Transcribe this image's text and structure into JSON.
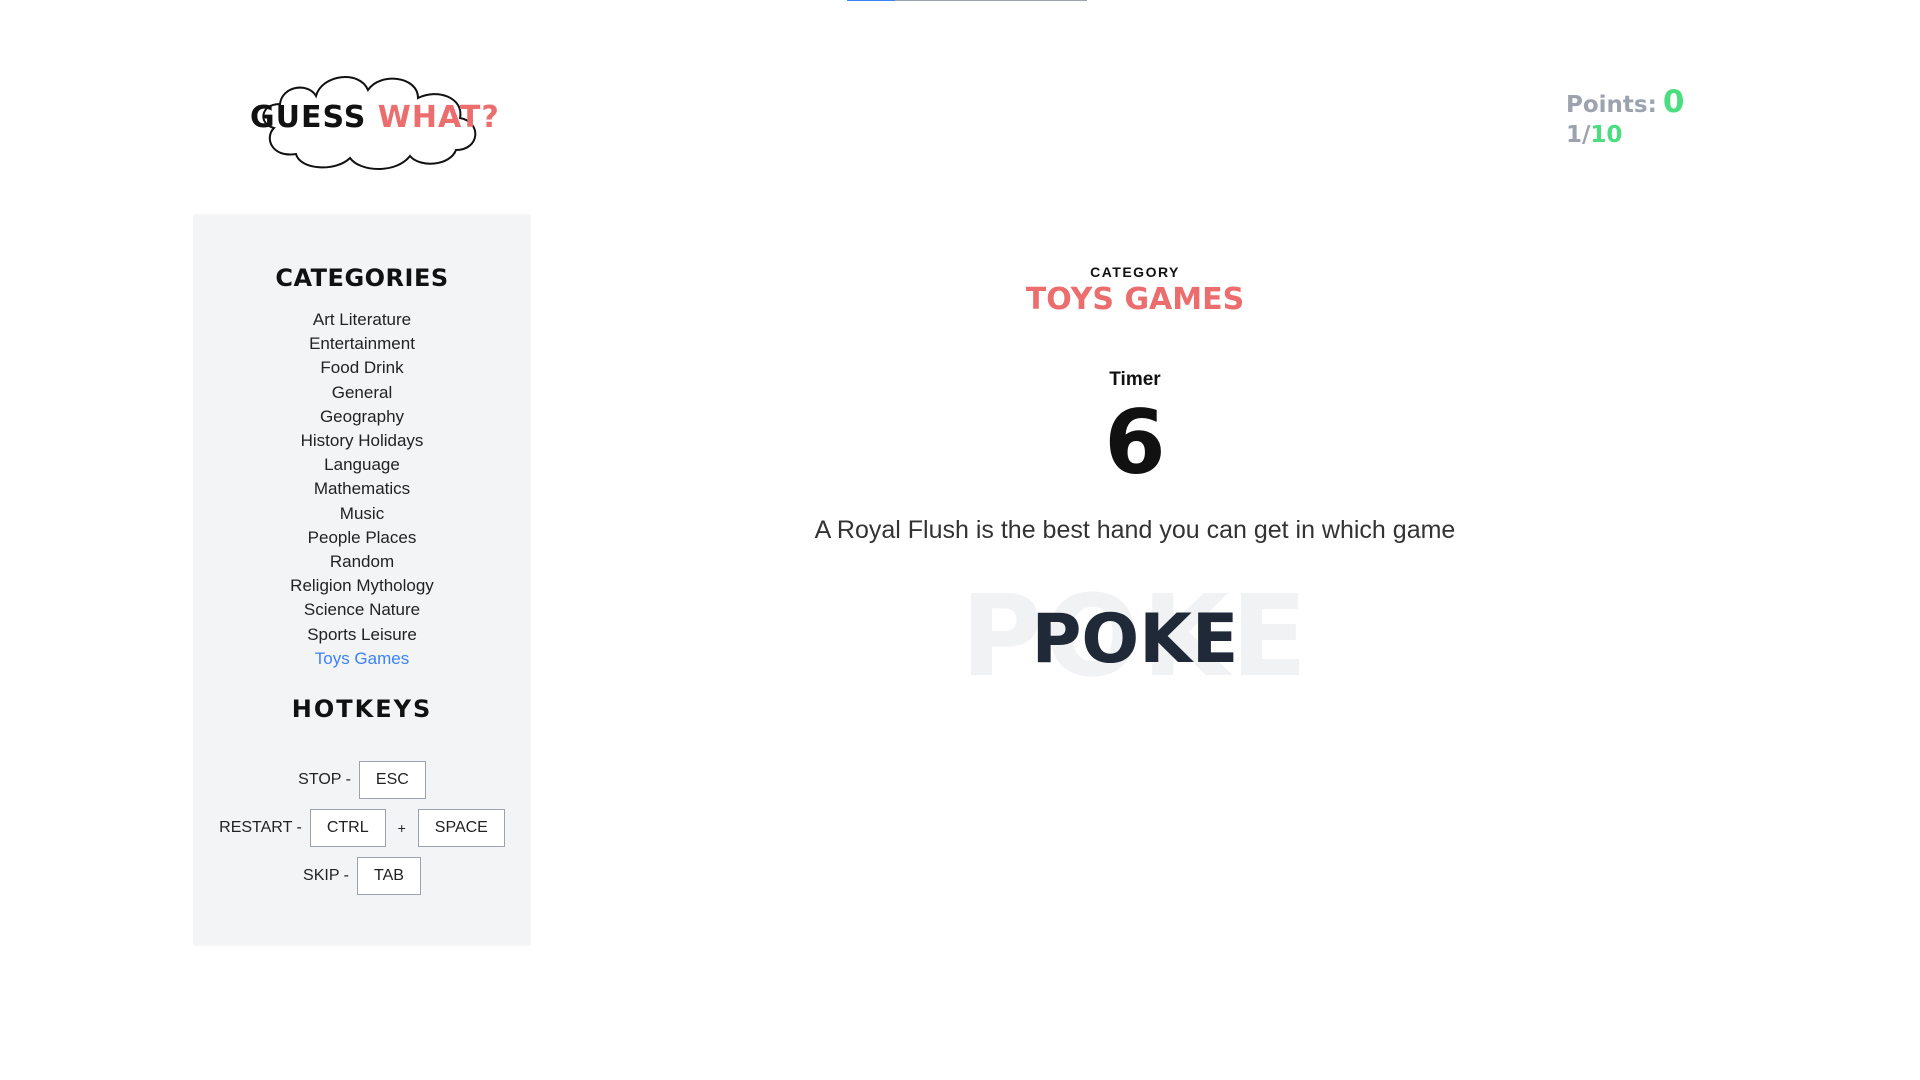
{
  "top_progress": {
    "fraction": 0.2
  },
  "logo": {
    "word1": "GUESS",
    "word2": "WHAT?"
  },
  "score": {
    "points_label": "Points:",
    "points_value": "0",
    "round_current": "1",
    "round_separator": "/",
    "round_total": "10"
  },
  "sidebar": {
    "categories_title": "CATEGORIES",
    "categories": [
      "Art Literature",
      "Entertainment",
      "Food Drink",
      "General",
      "Geography",
      "History Holidays",
      "Language",
      "Mathematics",
      "Music",
      "People Places",
      "Random",
      "Religion Mythology",
      "Science Nature",
      "Sports Leisure",
      "Toys Games"
    ],
    "active_category": "Toys Games",
    "hotkeys_title": "HOTKEYS",
    "hotkeys": {
      "stop_label": "STOP -",
      "stop_key": "ESC",
      "restart_label": "RESTART -",
      "restart_key1": "CTRL",
      "restart_plus": "+",
      "restart_key2": "SPACE",
      "skip_label": "SKIP -",
      "skip_key": "TAB"
    }
  },
  "game": {
    "category_label": "CATEGORY",
    "category_name": "TOYS GAMES",
    "timer_label": "Timer",
    "timer_value": "6",
    "question": "A Royal Flush is the best hand you can get in which game",
    "answer_ghost": "POKE",
    "answer_typed": "POKE"
  },
  "colors": {
    "accent_red": "#ec6d6d",
    "accent_green": "#4ade80",
    "link_blue": "#3b82f6",
    "muted": "#9ca3af"
  }
}
